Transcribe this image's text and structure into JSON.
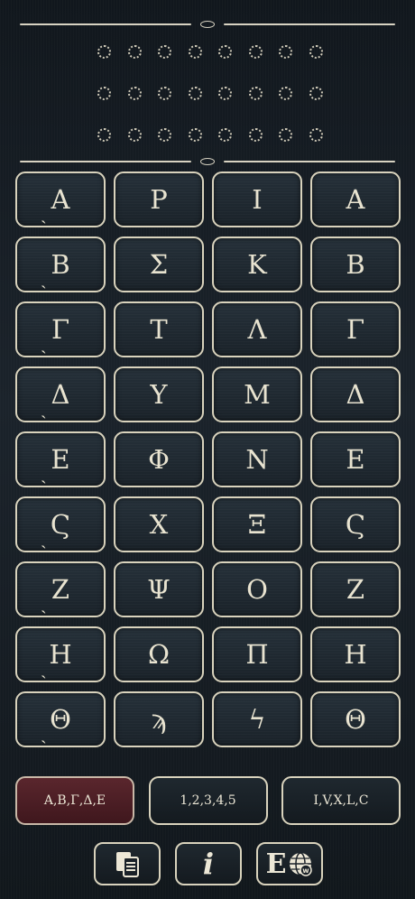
{
  "key_rows": [
    [
      {
        "label": "Α",
        "acc": "ˏ"
      },
      {
        "label": "Ρ"
      },
      {
        "label": "Ι"
      },
      {
        "label": "Α"
      }
    ],
    [
      {
        "label": "Β",
        "acc": "ˏ"
      },
      {
        "label": "Σ"
      },
      {
        "label": "Κ"
      },
      {
        "label": "Β"
      }
    ],
    [
      {
        "label": "Γ",
        "acc": "ˏ"
      },
      {
        "label": "Τ"
      },
      {
        "label": "Λ"
      },
      {
        "label": "Γ"
      }
    ],
    [
      {
        "label": "Δ",
        "acc": "ˏ"
      },
      {
        "label": "Υ"
      },
      {
        "label": "Μ"
      },
      {
        "label": "Δ"
      }
    ],
    [
      {
        "label": "Ε",
        "acc": "ˏ"
      },
      {
        "label": "Φ"
      },
      {
        "label": "Ν"
      },
      {
        "label": "Ε"
      }
    ],
    [
      {
        "label": "Ϛ",
        "acc": "ˏ"
      },
      {
        "label": "Χ"
      },
      {
        "label": "Ξ"
      },
      {
        "label": "Ϛ"
      }
    ],
    [
      {
        "label": "Ζ",
        "acc": "ˏ"
      },
      {
        "label": "Ψ"
      },
      {
        "label": "Ο"
      },
      {
        "label": "Ζ"
      }
    ],
    [
      {
        "label": "Η",
        "acc": "ˏ"
      },
      {
        "label": "Ω"
      },
      {
        "label": "Π"
      },
      {
        "label": "Η"
      }
    ],
    [
      {
        "label": "Θ",
        "acc": "ˏ"
      },
      {
        "label": "ϡ"
      },
      {
        "label": "ϟ"
      },
      {
        "label": "Θ"
      }
    ]
  ],
  "modes": [
    "Α,Β,Γ,Δ,Ε",
    "1,2,3,4,5",
    "Ι,V,X,L,C"
  ],
  "active_mode": 0,
  "tools": {
    "info_label": "i",
    "lang_label": "E",
    "globe_badge": "w"
  },
  "colors": {
    "background": "#11171d",
    "key_border": "#d9d3bd",
    "active_mode": "#5a262d"
  }
}
